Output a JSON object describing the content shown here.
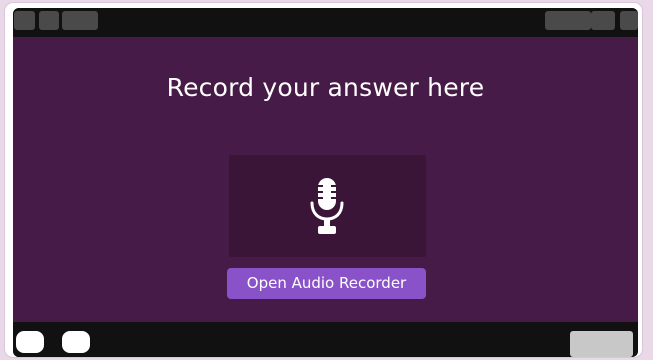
{
  "stage": {
    "heading": "Record your answer here",
    "mic_icon": "microphone-icon",
    "open_button_label": "Open Audio Recorder"
  },
  "colors": {
    "stage_background": "#471b47",
    "mic_box_background": "#3a1538",
    "button_accent": "#8a52c8",
    "chrome_background": "#111111"
  }
}
